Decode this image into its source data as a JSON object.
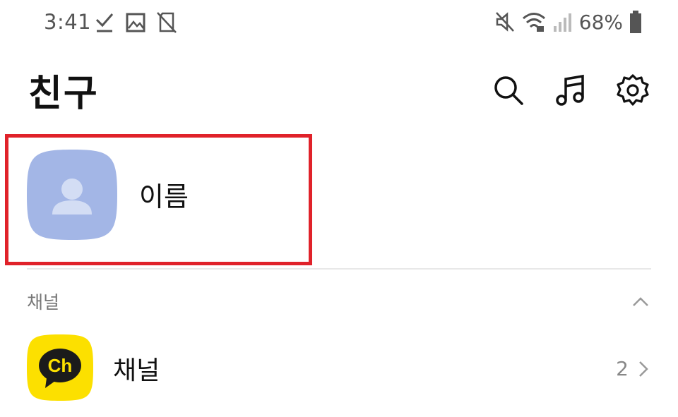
{
  "status_bar": {
    "time": "3:41",
    "left_icons": [
      "check-icon",
      "image-icon",
      "no-sim-icon"
    ],
    "right_icons": [
      "mute-icon",
      "wifi-icon",
      "signal-icon"
    ],
    "battery_percent": "68%"
  },
  "header": {
    "title": "친구",
    "actions": [
      "search-icon",
      "music-note-icon",
      "settings-gear-icon"
    ]
  },
  "profile": {
    "name": "이름",
    "avatar_color": "#a3b6e6",
    "highlight_color": "#e0222a"
  },
  "channels_section": {
    "title": "채널",
    "expanded": true
  },
  "channel_item": {
    "label": "채널",
    "count": "2",
    "icon_text": "Ch",
    "icon_color": "#fce000"
  }
}
